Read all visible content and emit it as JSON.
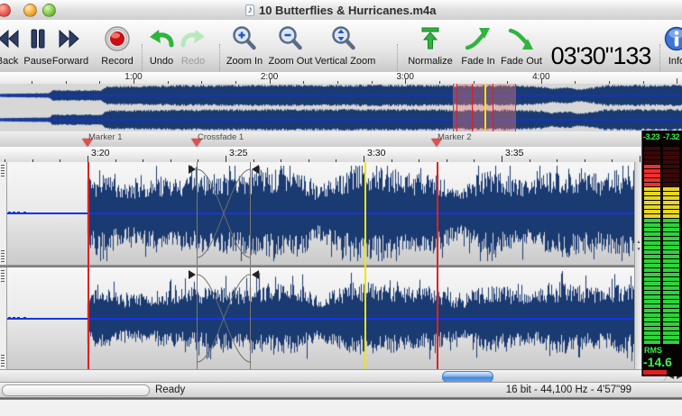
{
  "window": {
    "title": "10 Butterflies & Hurricanes.m4a"
  },
  "toolbar": {
    "buttons": [
      {
        "id": "back",
        "label": "Back",
        "icon": "skip-back-icon"
      },
      {
        "id": "pause",
        "label": "Pause",
        "icon": "pause-icon"
      },
      {
        "id": "forward",
        "label": "Forward",
        "icon": "fast-forward-icon"
      },
      {
        "id": "record",
        "label": "Record",
        "icon": "record-icon"
      },
      {
        "id": "undo",
        "label": "Undo",
        "icon": "undo-arrow-icon"
      },
      {
        "id": "redo",
        "label": "Redo",
        "icon": "redo-arrow-icon",
        "disabled": true
      },
      {
        "id": "zoom-in",
        "label": "Zoom In",
        "icon": "magnifier-plus-icon"
      },
      {
        "id": "zoom-out",
        "label": "Zoom Out",
        "icon": "magnifier-minus-icon"
      },
      {
        "id": "vertical-zoom",
        "label": "Vertical Zoom",
        "icon": "magnifier-vertical-icon"
      },
      {
        "id": "normalize",
        "label": "Normalize",
        "icon": "normalize-arrow-icon"
      },
      {
        "id": "fade-in",
        "label": "Fade In",
        "icon": "fade-in-arrow-icon"
      },
      {
        "id": "fade-out",
        "label": "Fade Out",
        "icon": "fade-out-arrow-icon"
      }
    ],
    "cursor_position": {
      "value": "03'30\"133",
      "label": "Cursor Position"
    },
    "info": {
      "label": "Info",
      "icon": "info-icon"
    }
  },
  "overview": {
    "ruler_labels": [
      "1:00",
      "2:00",
      "3:00",
      "4:00"
    ]
  },
  "markers": [
    {
      "label": "Marker 1"
    },
    {
      "label": "Crossfade 1"
    },
    {
      "label": "Marker 2"
    }
  ],
  "editor": {
    "ruler_labels": [
      "3:20",
      "3:25",
      "3:30",
      "3:35"
    ]
  },
  "meter": {
    "peak_left": "-3.23",
    "peak_right": "-7.32",
    "rms_label": "RMS",
    "rms_value": "-14.6",
    "left_bands": [
      [
        "dim",
        4
      ],
      [
        "red",
        5
      ],
      [
        "yellow",
        7
      ],
      [
        "green",
        28
      ]
    ],
    "right_bands": [
      [
        "dim",
        9
      ],
      [
        "yellow",
        7
      ],
      [
        "green",
        28
      ]
    ]
  },
  "status": {
    "message": "Ready",
    "format": "16 bit - 44,100 Hz - 4'57\"99"
  },
  "colors": {
    "waveform": "#1a3a72",
    "centerline": "#1535e0",
    "marker_line": "#e02020",
    "cursor_line": "#f2e400",
    "meter_dim": "#3a0808",
    "meter_red": "#ee3030",
    "meter_yellow": "#e6d625",
    "meter_green": "#2ed23a",
    "meter_text": "#3cf04e"
  }
}
